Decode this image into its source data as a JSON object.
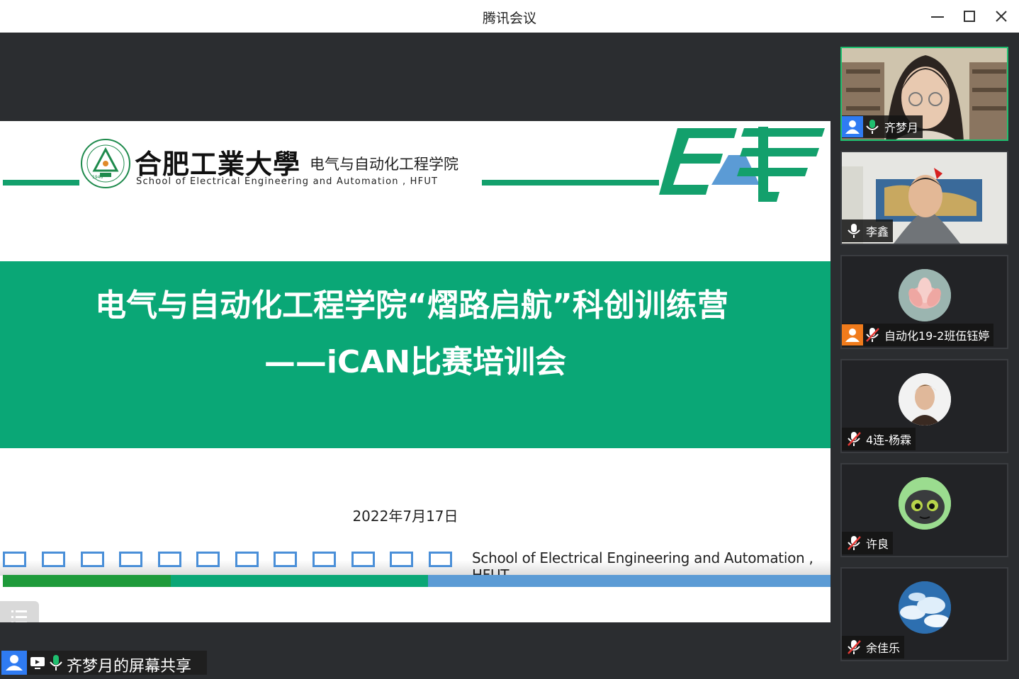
{
  "window": {
    "title": "腾讯会议"
  },
  "slide": {
    "university_name": "合肥工業大學",
    "school_cn": "电气与自动化工程学院",
    "school_en": "School of Electrical Engineering and Automation , HFUT",
    "seal_text": "1946",
    "headline_line1": "电气与自动化工程学院“熠路启航”科创训练营",
    "headline_line2": "——iCAN比赛培训会",
    "date": "2022年7月17日",
    "footer_text": "School  of  Electrical  Engineering  and  Automation , HFUT"
  },
  "share_bar": {
    "label": "齐梦月的屏幕共享"
  },
  "participants": [
    {
      "name": "齐梦月",
      "mic": "on",
      "video": true,
      "active": true,
      "badge": "host"
    },
    {
      "name": "李鑫",
      "mic": "on",
      "video": true,
      "active": false,
      "badge": ""
    },
    {
      "name": "自动化19-2班伍钰婷",
      "mic": "muted",
      "video": false,
      "active": false,
      "badge": "cohost"
    },
    {
      "name": "4连-杨霖",
      "mic": "muted",
      "video": false,
      "active": false,
      "badge": ""
    },
    {
      "name": "许良",
      "mic": "muted",
      "video": false,
      "active": false,
      "badge": ""
    },
    {
      "name": "余佳乐",
      "mic": "muted",
      "video": false,
      "active": false,
      "badge": ""
    }
  ],
  "colors": {
    "accent_green": "#0aa776",
    "dark_green": "#1e9a3a",
    "blue": "#5b9bd5",
    "mic_green": "#1fbf6f"
  }
}
